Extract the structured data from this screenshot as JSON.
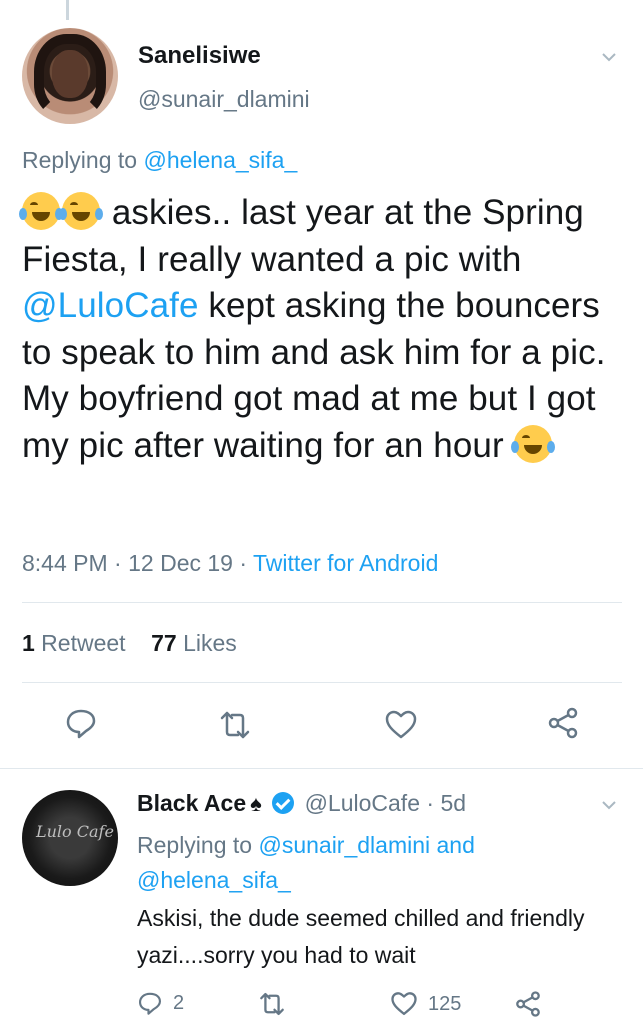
{
  "tweet": {
    "name": "Sanelisiwe",
    "handle": "@sunair_dlamini",
    "replying_prefix": "Replying to ",
    "replying_to": "@helena_sifa_",
    "text_part1": " askies.. last year at the Spring Fiesta, I really wanted a pic with ",
    "mention": "@LuloCafe",
    "text_part2": " kept asking the bouncers to speak to him and ask him for a pic. My boyfriend got mad at me but  I got my pic after waiting for an hour ",
    "time": "8:44 PM",
    "date": "12 Dec 19",
    "dot": "·",
    "source": "Twitter for Android",
    "retweet_count": "1",
    "retweet_label": " Retweet",
    "like_count": "77",
    "like_label": " Likes"
  },
  "reply": {
    "name": "Black Ace",
    "spade": "♠",
    "handle": "@LuloCafe",
    "time_ago": "· 5d",
    "replying_prefix": "Replying to ",
    "replying_to_1": "@sunair_dlamini",
    "and": " and ",
    "replying_to_2": "@helena_sifa_",
    "text": "Askisi, the dude seemed chilled and friendly yazi....sorry you had to wait",
    "reply_count": "2",
    "like_count": "125"
  },
  "avatar_logo": "Lulo Cafe",
  "icons": [
    "chevron-down-icon",
    "reply-icon",
    "retweet-icon",
    "like-icon",
    "share-icon",
    "verified-icon",
    "crying-laughing-emoji"
  ],
  "colors": {
    "link": "#1da1f2",
    "secondary": "#657786",
    "text": "#14171a",
    "divider": "#e1e8ed"
  }
}
